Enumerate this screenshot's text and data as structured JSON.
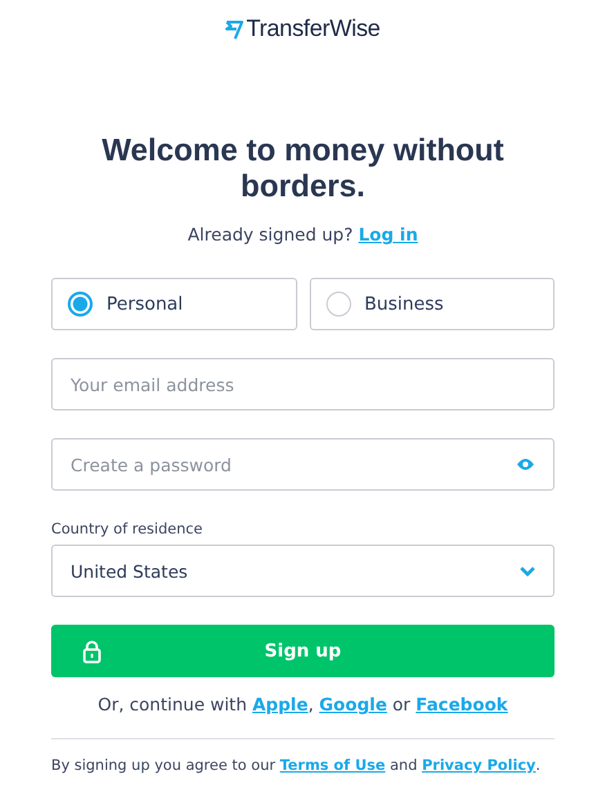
{
  "logo": {
    "text": "TransferWise"
  },
  "heading": "Welcome to money without borders.",
  "signin": [
    {
      "kind": "text",
      "text": "Already signed up? "
    },
    {
      "kind": "link",
      "text": "Log in"
    }
  ],
  "account_types": [
    {
      "label": "Personal",
      "selected": true
    },
    {
      "label": "Business",
      "selected": false
    }
  ],
  "email": {
    "placeholder": "Your email address"
  },
  "password": {
    "placeholder": "Create a password"
  },
  "country": {
    "label": "Country of residence",
    "value": "United States"
  },
  "submit": {
    "label": "Sign up"
  },
  "social": [
    {
      "kind": "text",
      "text": "Or, continue with "
    },
    {
      "kind": "link",
      "text": "Apple"
    },
    {
      "kind": "text",
      "text": ", "
    },
    {
      "kind": "link",
      "text": "Google"
    },
    {
      "kind": "text",
      "text": " or "
    },
    {
      "kind": "link",
      "text": "Facebook"
    }
  ],
  "terms": [
    {
      "kind": "text",
      "text": "By signing up you agree to our "
    },
    {
      "kind": "link",
      "text": "Terms of Use"
    },
    {
      "kind": "text",
      "text": " and "
    },
    {
      "kind": "link",
      "text": "Privacy Policy"
    },
    {
      "kind": "text",
      "text": "."
    }
  ]
}
